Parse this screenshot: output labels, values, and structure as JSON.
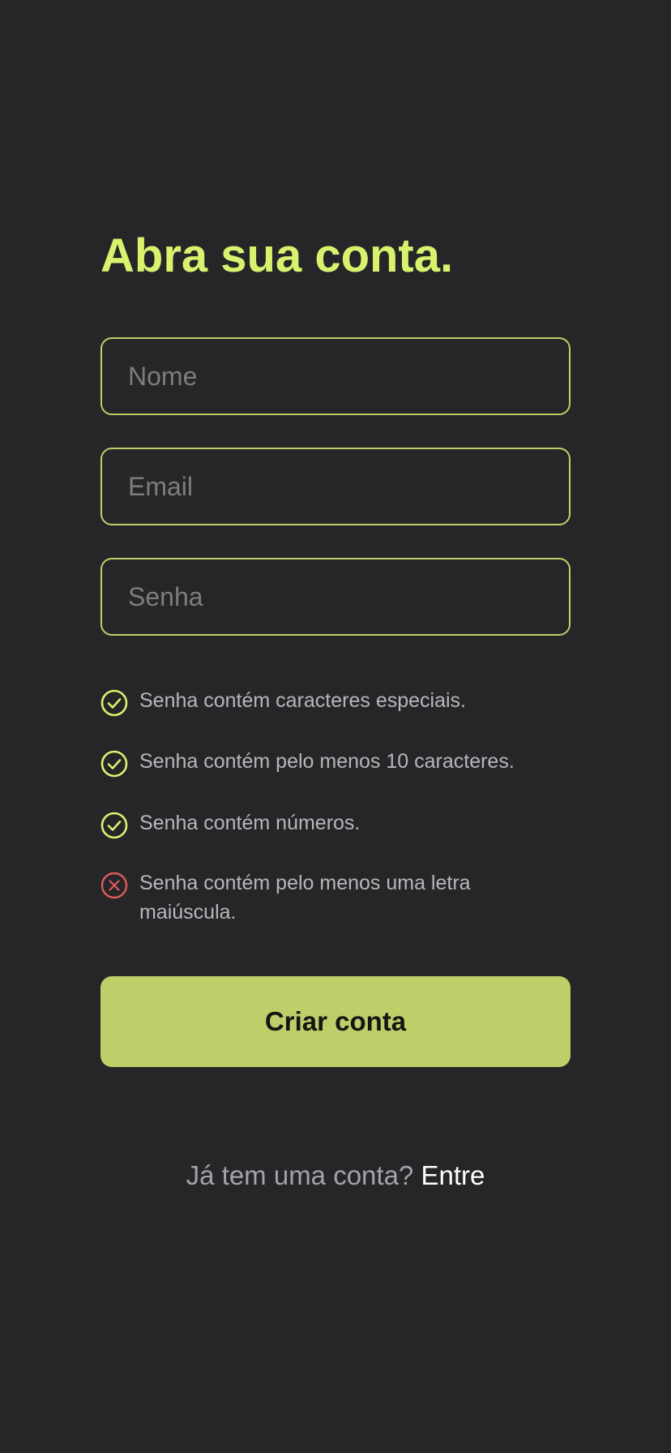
{
  "title": "Abra sua conta.",
  "form": {
    "name_placeholder": "Nome",
    "email_placeholder": "Email",
    "password_placeholder": "Senha"
  },
  "password_rules": [
    {
      "label": "Senha contém caracteres especiais.",
      "status": "met",
      "icon": "check-circle-icon"
    },
    {
      "label": "Senha contém pelo menos 10 caracteres.",
      "status": "met",
      "icon": "check-circle-icon"
    },
    {
      "label": "Senha contém números.",
      "status": "met",
      "icon": "check-circle-icon"
    },
    {
      "label": "Senha contém pelo menos uma letra maiúscula.",
      "status": "unmet",
      "icon": "x-circle-icon"
    }
  ],
  "submit_label": "Criar conta",
  "login_prompt": {
    "question": "Já tem uma conta?",
    "link_label": "Entre"
  },
  "colors": {
    "background": "#262628",
    "accent": "#d8f26e",
    "button": "#bccf68",
    "rule_met": "#d8f26e",
    "rule_unmet": "#e05a5a"
  }
}
